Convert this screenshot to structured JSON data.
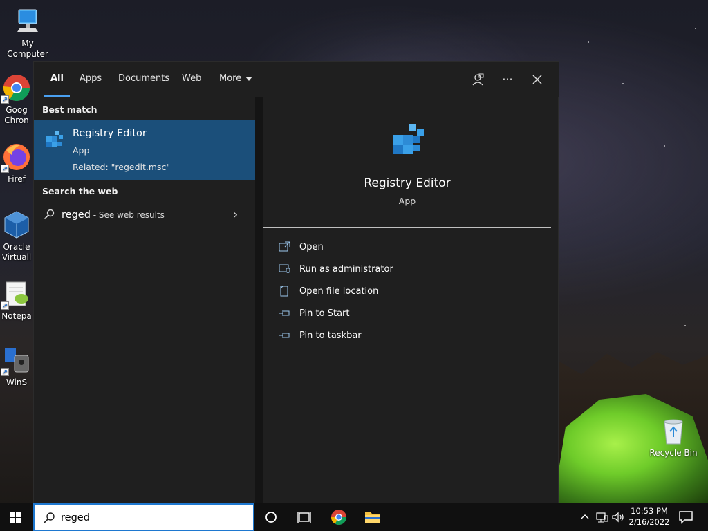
{
  "desktop": {
    "icons": [
      {
        "label": "My Computer"
      },
      {
        "label": "Goog Chron"
      },
      {
        "label": "Firef"
      },
      {
        "label": "Oracle Virtuall"
      },
      {
        "label": "Notepa"
      },
      {
        "label": "WinS"
      },
      {
        "label": "Recycle Bin"
      }
    ]
  },
  "start": {
    "tabs": [
      {
        "label": "All"
      },
      {
        "label": "Apps"
      },
      {
        "label": "Documents"
      },
      {
        "label": "Web"
      },
      {
        "label": "More"
      }
    ],
    "toolbar_icons": [
      "feedback-icon",
      "more-options-icon",
      "close-icon"
    ],
    "best_match_heading": "Best match",
    "best_match": {
      "title": "Registry Editor",
      "type": "App",
      "related": "Related: \"regedit.msc\""
    },
    "search_web_heading": "Search the web",
    "web_result": {
      "query": "reged",
      "suffix": " - See web results"
    },
    "preview": {
      "title": "Registry Editor",
      "type": "App",
      "actions": [
        {
          "label": "Open",
          "icon": "open-icon"
        },
        {
          "label": "Run as administrator",
          "icon": "run-as-admin-icon"
        },
        {
          "label": "Open file location",
          "icon": "file-location-icon"
        },
        {
          "label": "Pin to Start",
          "icon": "pin-icon"
        },
        {
          "label": "Pin to taskbar",
          "icon": "pin-icon"
        }
      ]
    }
  },
  "taskbar": {
    "search_value": "reged",
    "clock_time": "10:53 PM",
    "clock_date": "2/16/2022"
  },
  "colors": {
    "accent": "#1b4f7a",
    "tab_underline": "#4aa0f0",
    "panel_bg": "#1f1f1f",
    "taskbar_bg": "#101010"
  }
}
